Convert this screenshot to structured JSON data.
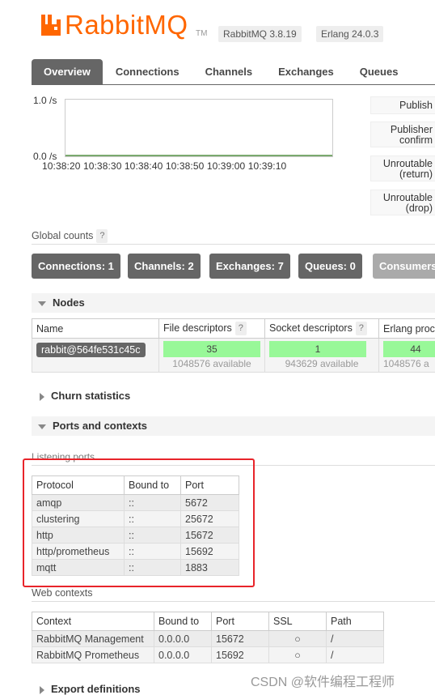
{
  "header": {
    "logo_text": "RabbitMQ",
    "logo_tm": "TM",
    "version": "RabbitMQ 3.8.19",
    "erlang": "Erlang 24.0.3"
  },
  "tabs": [
    {
      "label": "Overview"
    },
    {
      "label": "Connections"
    },
    {
      "label": "Channels"
    },
    {
      "label": "Exchanges"
    },
    {
      "label": "Queues"
    }
  ],
  "chart_data": {
    "type": "line",
    "y_ticks": [
      "1.0 /s",
      "0.0 /s"
    ],
    "ylim": [
      0.0,
      1.0
    ],
    "x_ticks": [
      "10:38:20",
      "10:38:30",
      "10:38:40",
      "10:38:50",
      "10:39:00",
      "10:39:10"
    ],
    "series": [
      {
        "values": [
          0,
          0,
          0,
          0,
          0,
          0
        ]
      }
    ],
    "colors": {
      "line": "#7aa96e"
    }
  },
  "legend": [
    "Publish",
    "Publisher confirm",
    "Unroutable (return)",
    "Unroutable (drop)"
  ],
  "global_counts": {
    "label": "Global counts",
    "help": "?",
    "buttons": [
      "Connections: 1",
      "Channels: 2",
      "Exchanges: 7",
      "Queues: 0",
      "Consumers"
    ]
  },
  "nodes": {
    "title": "Nodes",
    "columns": [
      "Name",
      "File descriptors",
      "Socket descriptors",
      "Erlang proc"
    ],
    "help": "?",
    "row": {
      "name": "rabbit@564fe531c45c",
      "file_desc": "35",
      "file_avail": "1048576 available",
      "socket_desc": "1",
      "socket_avail": "943629 available",
      "erlang_proc": "44",
      "erlang_avail": "1048576 a"
    }
  },
  "churn": {
    "title": "Churn statistics"
  },
  "ports_contexts": {
    "title": "Ports and contexts"
  },
  "listening_ports": {
    "label": "Listening ports",
    "columns": [
      "Protocol",
      "Bound to",
      "Port"
    ],
    "rows": [
      [
        "amqp",
        "::",
        "5672"
      ],
      [
        "clustering",
        "::",
        "25672"
      ],
      [
        "http",
        "::",
        "15672"
      ],
      [
        "http/prometheus",
        "::",
        "15692"
      ],
      [
        "mqtt",
        "::",
        "1883"
      ]
    ]
  },
  "web_contexts": {
    "label": "Web contexts",
    "columns": [
      "Context",
      "Bound to",
      "Port",
      "SSL",
      "Path"
    ],
    "rows": [
      [
        "RabbitMQ Management",
        "0.0.0.0",
        "15672",
        "○",
        "/"
      ],
      [
        "RabbitMQ Prometheus",
        "0.0.0.0",
        "15692",
        "○",
        "/"
      ]
    ]
  },
  "export": {
    "title": "Export definitions"
  },
  "watermark": "CSDN @软件编程工程师",
  "colors": {
    "brand": "#ff6600",
    "tab_active": "#666666",
    "meter": "#98f898",
    "highlight": "#e8242a"
  }
}
